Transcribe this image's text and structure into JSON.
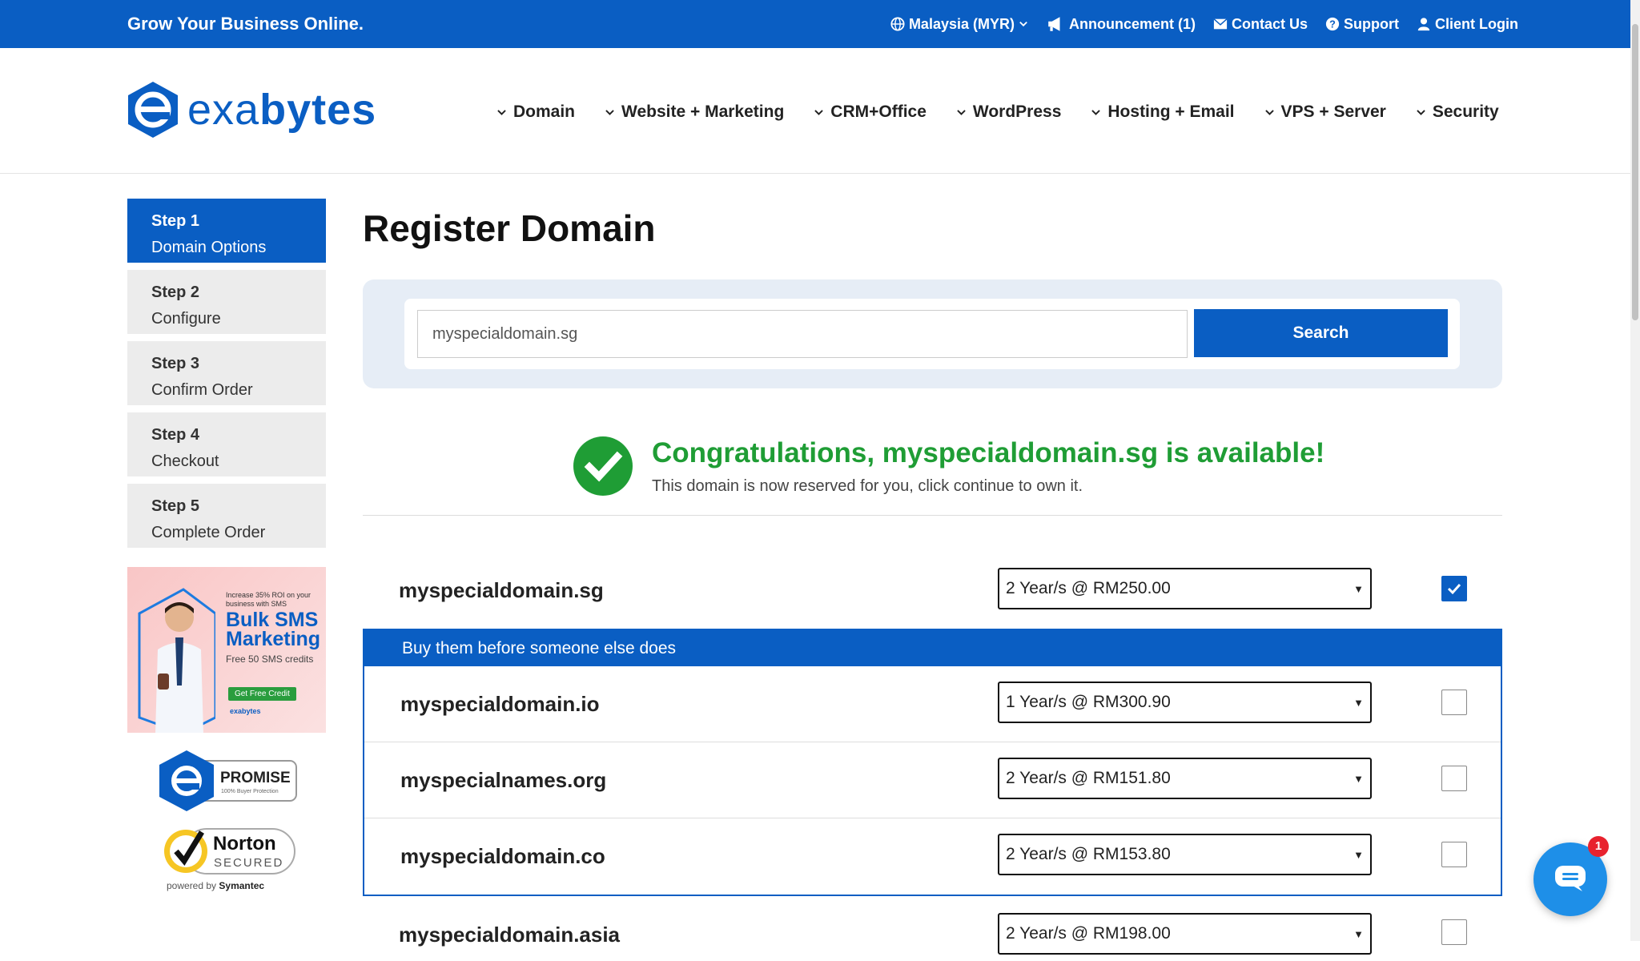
{
  "topbar": {
    "tagline": "Grow Your Business Online.",
    "region": "Malaysia (MYR)",
    "announcement": "Announcement (1)",
    "contact": "Contact Us",
    "support": "Support",
    "login": "Client Login"
  },
  "brand": {
    "name_light": "exa",
    "name_bold": "bytes"
  },
  "nav": [
    "Domain",
    "Website + Marketing",
    "CRM+Office",
    "WordPress",
    "Hosting + Email",
    "VPS + Server",
    "Security"
  ],
  "steps": [
    {
      "num": "Step 1",
      "label": "Domain Options"
    },
    {
      "num": "Step 2",
      "label": "Configure"
    },
    {
      "num": "Step 3",
      "label": "Confirm Order"
    },
    {
      "num": "Step 4",
      "label": "Checkout"
    },
    {
      "num": "Step 5",
      "label": "Complete Order"
    }
  ],
  "promo": {
    "line1": "Increase 35% ROI on your business with SMS",
    "headline": "Bulk SMS Marketing",
    "line2": "Free 50 SMS credits",
    "cta": "Get Free Credit",
    "brand": "exabytes"
  },
  "badges": {
    "promise": "PROMISE",
    "promise_sub": "100% Buyer Protection",
    "norton": "Norton",
    "secured": "SECURED",
    "powered": "powered by",
    "symantec": "Symantec"
  },
  "page": {
    "title": "Register Domain"
  },
  "search": {
    "value": "myspecialdomain.sg",
    "button": "Search"
  },
  "availability": {
    "headline": "Congratulations, myspecialdomain.sg is available!",
    "sub": "This domain is now reserved for you, click continue to own it."
  },
  "primary": {
    "domain": "myspecialdomain.sg",
    "period": "2 Year/s @ RM250.00",
    "checked": true
  },
  "suggestions_header": "Buy them before someone else does",
  "suggestions": [
    {
      "domain": "myspecialdomain.io",
      "period": "1 Year/s @ RM300.90"
    },
    {
      "domain": "myspecialnames.org",
      "period": "2 Year/s @ RM151.80"
    },
    {
      "domain": "myspecialdomain.co",
      "period": "2 Year/s @ RM153.80"
    }
  ],
  "extra": {
    "domain": "myspecialdomain.asia",
    "period": "2 Year/s @ RM198.00"
  },
  "chat": {
    "notifications": "1"
  },
  "colors": {
    "primary": "#0a5ec3",
    "success": "#1f9d35",
    "chat": "#1e8fe8",
    "badge": "#e8222e"
  }
}
